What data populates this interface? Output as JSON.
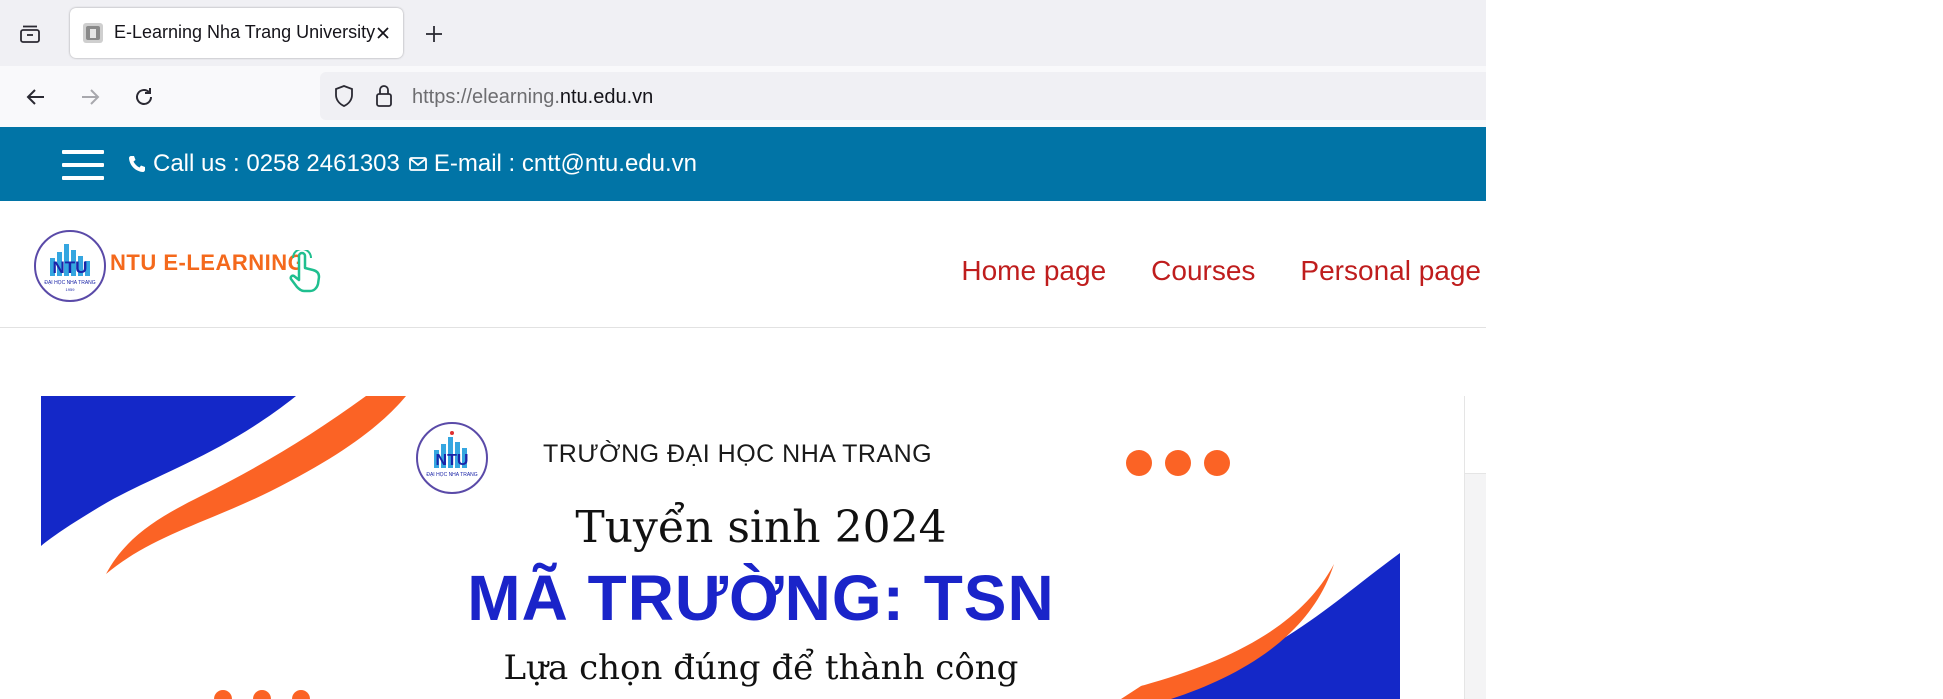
{
  "browser": {
    "tab": {
      "title": "E-Learning Nha Trang University",
      "close_icon": "close-icon"
    },
    "url": {
      "protocol": "https://elearning.",
      "domain": "ntu.edu.vn"
    }
  },
  "topbar": {
    "call_label": "Call us : 0258 2461303",
    "email_label": "E-mail : cntt@ntu.edu.vn",
    "background": "#0174a6"
  },
  "site_header": {
    "brand": "NTU E-LEARNING",
    "nav": [
      {
        "label": "Home page"
      },
      {
        "label": "Courses"
      },
      {
        "label": "Personal page"
      }
    ],
    "nav_color": "#bf1d1d"
  },
  "banner": {
    "school": "TRƯỜNG ĐẠI HỌC NHA TRANG",
    "headline": "Tuyển sinh 2024",
    "code": "MÃ TRƯỜNG: TSN",
    "slogan": "Lựa chọn đúng để thành công",
    "colors": {
      "blue": "#1428c8",
      "orange": "#fb6325"
    }
  }
}
